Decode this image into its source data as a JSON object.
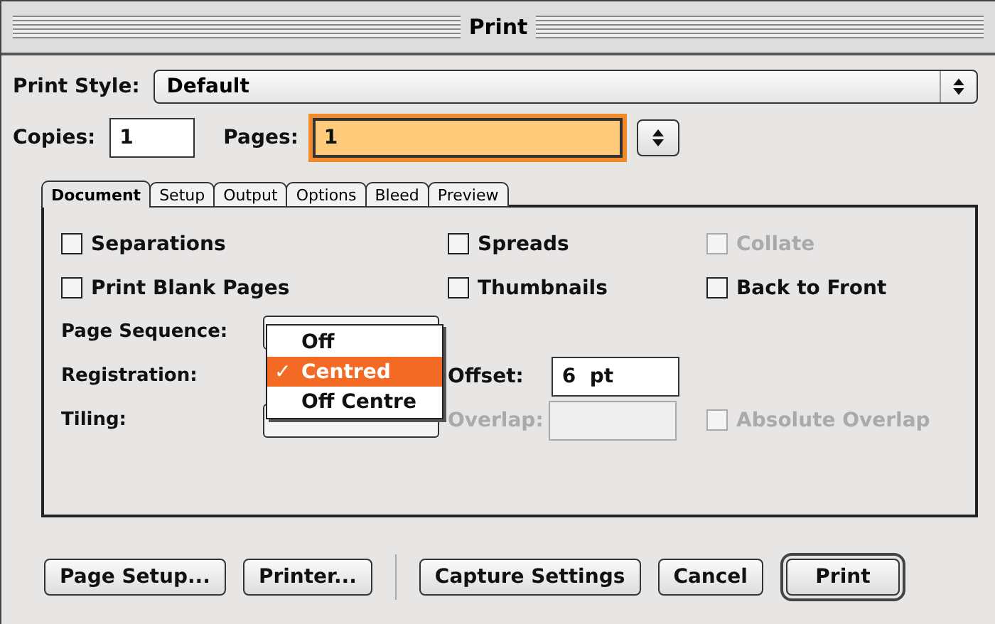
{
  "window": {
    "title": "Print"
  },
  "print_style": {
    "label": "Print Style:",
    "value": "Default"
  },
  "copies": {
    "label": "Copies:",
    "value": "1"
  },
  "pages": {
    "label": "Pages:",
    "value": "1",
    "focused": true
  },
  "tabs": [
    {
      "label": "Document",
      "selected": true
    },
    {
      "label": "Setup",
      "selected": false
    },
    {
      "label": "Output",
      "selected": false
    },
    {
      "label": "Options",
      "selected": false
    },
    {
      "label": "Bleed",
      "selected": false
    },
    {
      "label": "Preview",
      "selected": false
    }
  ],
  "checkboxes": [
    {
      "label": "Separations",
      "checked": false,
      "disabled": false
    },
    {
      "label": "Spreads",
      "checked": false,
      "disabled": false
    },
    {
      "label": "Collate",
      "checked": false,
      "disabled": true
    },
    {
      "label": "Print Blank Pages",
      "checked": false,
      "disabled": false
    },
    {
      "label": "Thumbnails",
      "checked": false,
      "disabled": false
    },
    {
      "label": "Back to Front",
      "checked": false,
      "disabled": false
    }
  ],
  "page_sequence": {
    "label": "Page Sequence:"
  },
  "registration": {
    "label": "Registration:",
    "menu": [
      {
        "label": "Off",
        "selected": false
      },
      {
        "label": "Centred",
        "selected": true
      },
      {
        "label": "Off Centre",
        "selected": false
      }
    ],
    "check_mark": "✓"
  },
  "offset": {
    "label": "Offset:",
    "value": "6  pt",
    "disabled": false
  },
  "tiling": {
    "label": "Tiling:"
  },
  "overlap": {
    "label": "Overlap:",
    "disabled": true
  },
  "absolute_overlap": {
    "label": "Absolute Overlap",
    "checked": false,
    "disabled": true
  },
  "buttons": [
    {
      "label": "Page Setup...",
      "kind": "normal"
    },
    {
      "label": "Printer...",
      "kind": "normal"
    },
    {
      "label": "Capture Settings",
      "kind": "normal"
    },
    {
      "label": "Cancel",
      "kind": "normal"
    },
    {
      "label": "Print",
      "kind": "default"
    }
  ]
}
